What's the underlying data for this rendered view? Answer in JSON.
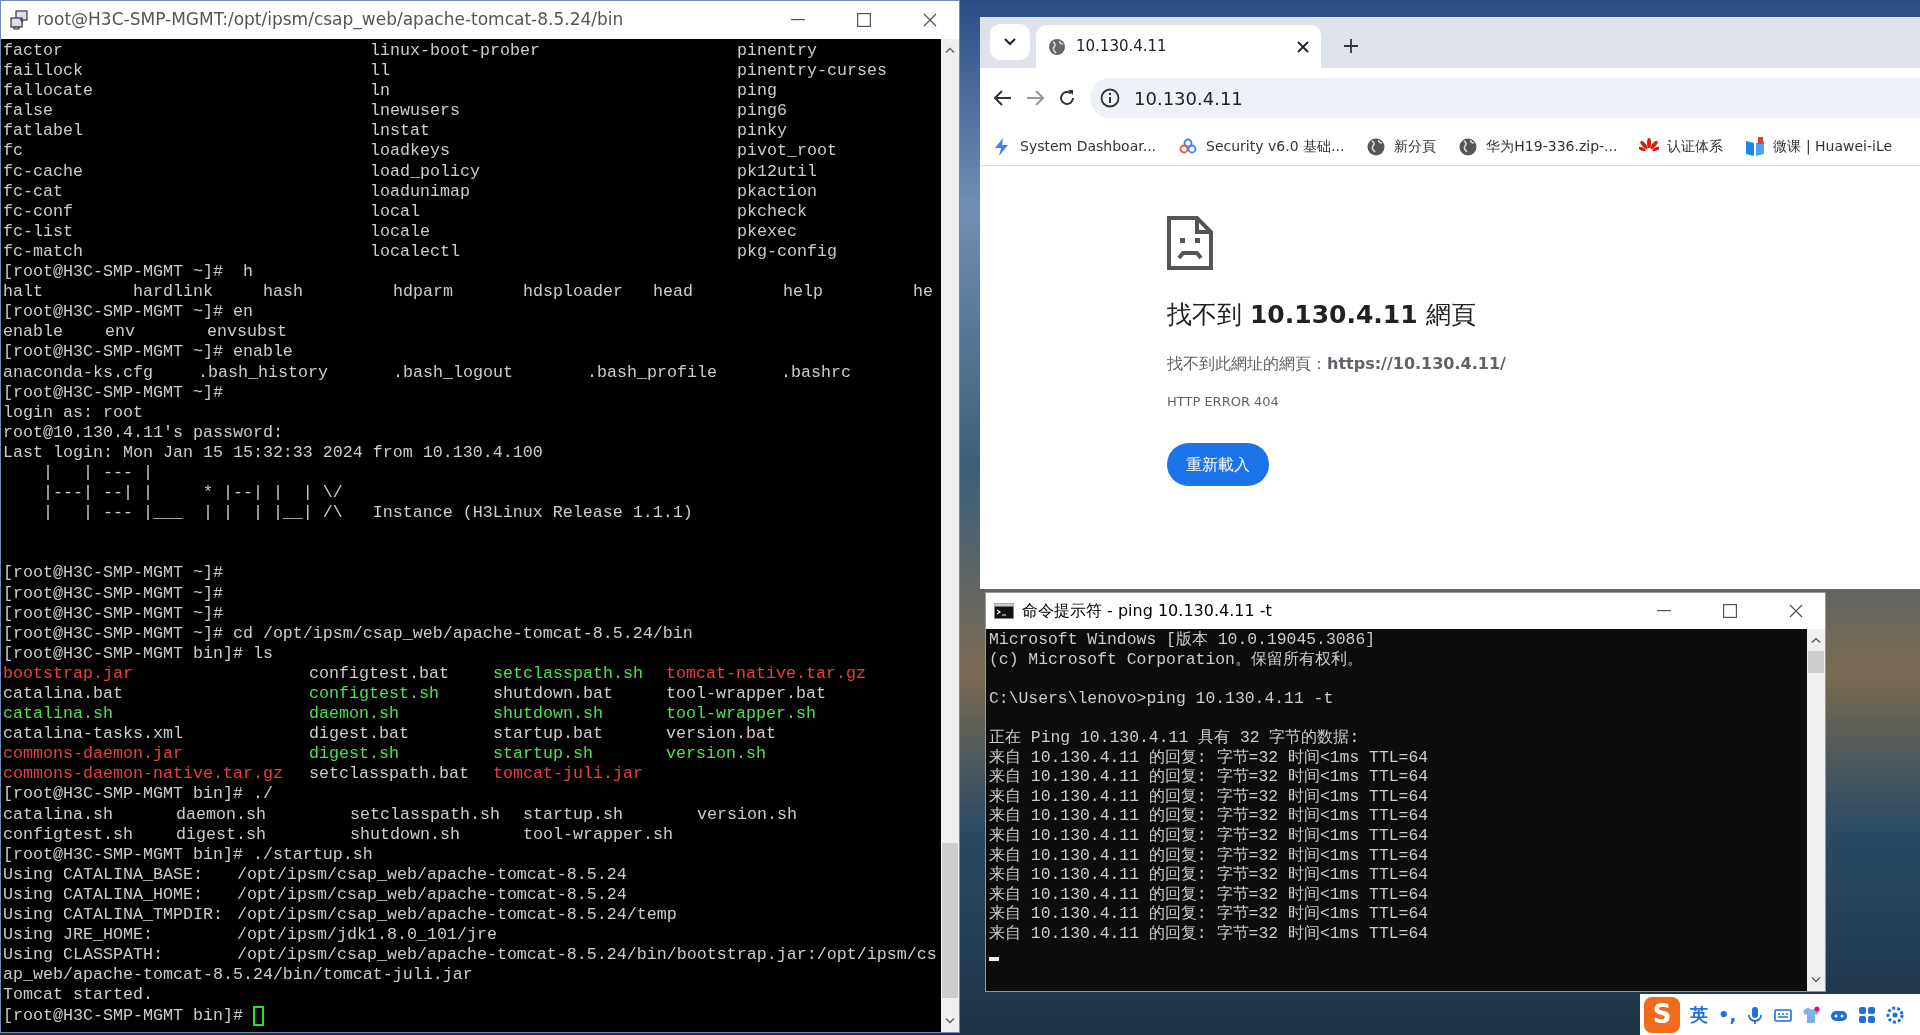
{
  "terminal_window": {
    "title": "root@H3C-SMP-MGMT:/opt/ipsm/csap_web/apache-tomcat-8.5.24/bin",
    "lines": [
      {
        "kind": "columns",
        "cells": [
          {
            "text": "factor"
          },
          {
            "text": "linux-boot-prober"
          },
          {
            "text": "pinentry"
          }
        ]
      },
      {
        "kind": "columns",
        "cells": [
          {
            "text": "faillock"
          },
          {
            "text": "ll"
          },
          {
            "text": "pinentry-curses"
          }
        ]
      },
      {
        "kind": "columns",
        "cells": [
          {
            "text": "fallocate"
          },
          {
            "text": "ln"
          },
          {
            "text": "ping"
          }
        ]
      },
      {
        "kind": "columns",
        "cells": [
          {
            "text": "false"
          },
          {
            "text": "lnewusers"
          },
          {
            "text": "ping6"
          }
        ]
      },
      {
        "kind": "columns",
        "cells": [
          {
            "text": "fatlabel"
          },
          {
            "text": "lnstat"
          },
          {
            "text": "pinky"
          }
        ]
      },
      {
        "kind": "columns",
        "cells": [
          {
            "text": "fc"
          },
          {
            "text": "loadkeys"
          },
          {
            "text": "pivot_root"
          }
        ]
      },
      {
        "kind": "columns",
        "cells": [
          {
            "text": "fc-cache"
          },
          {
            "text": "load_policy"
          },
          {
            "text": "pk12util"
          }
        ]
      },
      {
        "kind": "columns",
        "cells": [
          {
            "text": "fc-cat"
          },
          {
            "text": "loadunimap"
          },
          {
            "text": "pkaction"
          }
        ]
      },
      {
        "kind": "columns",
        "cells": [
          {
            "text": "fc-conf"
          },
          {
            "text": "local"
          },
          {
            "text": "pkcheck"
          }
        ]
      },
      {
        "kind": "columns",
        "cells": [
          {
            "text": "fc-list"
          },
          {
            "text": "locale"
          },
          {
            "text": "pkexec"
          }
        ]
      },
      {
        "kind": "columns",
        "cells": [
          {
            "text": "fc-match"
          },
          {
            "text": "localectl"
          },
          {
            "text": "pkg-config"
          }
        ]
      },
      {
        "kind": "text",
        "text": "[root@H3C-SMP-MGMT ~]#  h"
      },
      {
        "kind": "columns",
        "cells": [
          {
            "text": "halt"
          },
          {
            "text": "hardlink"
          },
          {
            "text": "hash"
          },
          {
            "text": "hdparm"
          },
          {
            "text": "hdsploader"
          },
          {
            "text": "head"
          },
          {
            "text": "help"
          },
          {
            "text": "he"
          }
        ]
      },
      {
        "kind": "text",
        "text": "[root@H3C-SMP-MGMT ~]# en"
      },
      {
        "kind": "columns",
        "cells": [
          {
            "text": "enable"
          },
          {
            "text": "env"
          },
          {
            "text": "envsubst"
          }
        ]
      },
      {
        "kind": "text",
        "text": "[root@H3C-SMP-MGMT ~]# enable"
      },
      {
        "kind": "columns",
        "cells": [
          {
            "text": "anaconda-ks.cfg"
          },
          {
            "text": ".bash_history"
          },
          {
            "text": ".bash_logout"
          },
          {
            "text": ".bash_profile"
          },
          {
            "text": ".bashrc"
          }
        ]
      },
      {
        "kind": "text",
        "text": "[root@H3C-SMP-MGMT ~]#"
      },
      {
        "kind": "text",
        "text": "login as: root"
      },
      {
        "kind": "text",
        "text": "root@10.130.4.11's password:"
      },
      {
        "kind": "text",
        "text": "Last login: Mon Jan 15 15:32:33 2024 from 10.130.4.100"
      },
      {
        "kind": "art",
        "text": "    |   | --- |"
      },
      {
        "kind": "art",
        "text": "    |---| --| |     * |--| |  | \\/"
      },
      {
        "kind": "art",
        "text": "    |   | --- |___  | |  | |__| /\\   Instance (H3Linux Release 1.1.1)"
      },
      {
        "kind": "blank"
      },
      {
        "kind": "blank"
      },
      {
        "kind": "text",
        "text": "[root@H3C-SMP-MGMT ~]#"
      },
      {
        "kind": "text",
        "text": "[root@H3C-SMP-MGMT ~]#"
      },
      {
        "kind": "text",
        "text": "[root@H3C-SMP-MGMT ~]#"
      },
      {
        "kind": "text",
        "text": "[root@H3C-SMP-MGMT ~]# cd /opt/ipsm/csap_web/apache-tomcat-8.5.24/bin"
      },
      {
        "kind": "text",
        "text": "[root@H3C-SMP-MGMT bin]# ls"
      },
      {
        "kind": "columns",
        "cells": [
          {
            "text": "bootstrap.jar",
            "color": "#e8413b"
          },
          {
            "text": "configtest.bat",
            "color": "#cccccc"
          },
          {
            "text": "setclasspath.sh",
            "color": "#4ee14e"
          },
          {
            "text": "tomcat-native.tar.gz",
            "color": "#e8413b"
          }
        ]
      },
      {
        "kind": "columns",
        "cells": [
          {
            "text": "catalina.bat",
            "color": "#cccccc"
          },
          {
            "text": "configtest.sh",
            "color": "#4ee14e"
          },
          {
            "text": "shutdown.bat",
            "color": "#cccccc"
          },
          {
            "text": "tool-wrapper.bat",
            "color": "#cccccc"
          }
        ]
      },
      {
        "kind": "columns",
        "cells": [
          {
            "text": "catalina.sh",
            "color": "#4ee14e"
          },
          {
            "text": "daemon.sh",
            "color": "#4ee14e"
          },
          {
            "text": "shutdown.sh",
            "color": "#4ee14e"
          },
          {
            "text": "tool-wrapper.sh",
            "color": "#4ee14e"
          }
        ]
      },
      {
        "kind": "columns",
        "cells": [
          {
            "text": "catalina-tasks.xml",
            "color": "#cccccc"
          },
          {
            "text": "digest.bat",
            "color": "#cccccc"
          },
          {
            "text": "startup.bat",
            "color": "#cccccc"
          },
          {
            "text": "version.bat",
            "color": "#cccccc"
          }
        ]
      },
      {
        "kind": "columns",
        "cells": [
          {
            "text": "commons-daemon.jar",
            "color": "#e8413b"
          },
          {
            "text": "digest.sh",
            "color": "#4ee14e"
          },
          {
            "text": "startup.sh",
            "color": "#4ee14e"
          },
          {
            "text": "version.sh",
            "color": "#4ee14e"
          }
        ]
      },
      {
        "kind": "columns",
        "cells": [
          {
            "text": "commons-daemon-native.tar.gz",
            "color": "#e8413b"
          },
          {
            "text": "setclasspath.bat",
            "color": "#cccccc"
          },
          {
            "text": "tomcat-juli.jar",
            "color": "#e8413b"
          }
        ]
      },
      {
        "kind": "text",
        "text": "[root@H3C-SMP-MGMT bin]# ./"
      },
      {
        "kind": "columns",
        "cells": [
          {
            "text": "catalina.sh"
          },
          {
            "text": "daemon.sh"
          },
          {
            "text": "setclasspath.sh"
          },
          {
            "text": "startup.sh"
          },
          {
            "text": "version.sh"
          }
        ]
      },
      {
        "kind": "columns",
        "cells": [
          {
            "text": "configtest.sh"
          },
          {
            "text": "digest.sh"
          },
          {
            "text": "shutdown.sh"
          },
          {
            "text": "tool-wrapper.sh"
          }
        ]
      },
      {
        "kind": "text",
        "text": "[root@H3C-SMP-MGMT bin]# ./startup.sh"
      },
      {
        "kind": "columns",
        "cells": [
          {
            "text": "Using CATALINA_BASE:"
          },
          {
            "text": "/opt/ipsm/csap_web/apache-tomcat-8.5.24"
          }
        ]
      },
      {
        "kind": "columns",
        "cells": [
          {
            "text": "Using CATALINA_HOME:"
          },
          {
            "text": "/opt/ipsm/csap_web/apache-tomcat-8.5.24"
          }
        ]
      },
      {
        "kind": "columns",
        "cells": [
          {
            "text": "Using CATALINA_TMPDIR:"
          },
          {
            "text": "/opt/ipsm/csap_web/apache-tomcat-8.5.24/temp"
          }
        ]
      },
      {
        "kind": "columns",
        "cells": [
          {
            "text": "Using JRE_HOME:"
          },
          {
            "text": "/opt/ipsm/jdk1.8.0_101/jre"
          }
        ]
      },
      {
        "kind": "columns",
        "cells": [
          {
            "text": "Using CLASSPATH:"
          },
          {
            "text": "/opt/ipsm/csap_web/apache-tomcat-8.5.24/bin/bootstrap.jar:/opt/ipsm/cs"
          }
        ]
      },
      {
        "kind": "text",
        "text": "ap_web/apache-tomcat-8.5.24/bin/tomcat-juli.jar"
      },
      {
        "kind": "text",
        "text": "Tomcat started."
      },
      {
        "kind": "text",
        "text": "[root@H3C-SMP-MGMT bin]#",
        "cursor": true
      }
    ]
  },
  "browser": {
    "tabs": [
      {
        "title": "10.130.4.11",
        "selected": true
      }
    ],
    "address": "10.130.4.11",
    "bookmarks": [
      {
        "kind": "bolt",
        "label": "System Dashboar..."
      },
      {
        "kind": "cluster",
        "label": "Security v6.0 基础..."
      },
      {
        "kind": "globe",
        "label": "新分頁"
      },
      {
        "kind": "globe",
        "label": "华为H19-336.zip-..."
      },
      {
        "kind": "flower",
        "label": "认证体系"
      },
      {
        "kind": "book",
        "label": "微课 | Huawei-iLe"
      }
    ],
    "error_page": {
      "heading": "找不到 **10.130.4.11** 網頁",
      "detail": "找不到此網址的網頁：**https://10.130.4.11/**",
      "code": "HTTP ERROR 404",
      "button": "重新載入"
    }
  },
  "console_window": {
    "title": "命令提示符 - ping  10.130.4.11 -t",
    "lines": [
      {
        "kind": "text",
        "text": "Microsoft Windows [版本 10.0.19045.3086]"
      },
      {
        "kind": "text",
        "text": "(c) Microsoft Corporation。保留所有权利。"
      },
      {
        "kind": "blank"
      },
      {
        "kind": "text",
        "text": "C:\\Users\\lenovo>ping 10.130.4.11 -t"
      },
      {
        "kind": "blank"
      },
      {
        "kind": "text",
        "text": "正在 Ping 10.130.4.11 具有 32 字节的数据:"
      },
      {
        "kind": "text",
        "text": "来自 10.130.4.11 的回复: 字节=32 时间<1ms TTL=64"
      },
      {
        "kind": "text",
        "text": "来自 10.130.4.11 的回复: 字节=32 时间<1ms TTL=64"
      },
      {
        "kind": "text",
        "text": "来自 10.130.4.11 的回复: 字节=32 时间<1ms TTL=64"
      },
      {
        "kind": "text",
        "text": "来自 10.130.4.11 的回复: 字节=32 时间<1ms TTL=64"
      },
      {
        "kind": "text",
        "text": "来自 10.130.4.11 的回复: 字节=32 时间<1ms TTL=64"
      },
      {
        "kind": "text",
        "text": "来自 10.130.4.11 的回复: 字节=32 时间<1ms TTL=64"
      },
      {
        "kind": "text",
        "text": "来自 10.130.4.11 的回复: 字节=32 时间<1ms TTL=64"
      },
      {
        "kind": "text",
        "text": "来自 10.130.4.11 的回复: 字节=32 时间<1ms TTL=64"
      },
      {
        "kind": "text",
        "text": "来自 10.130.4.11 的回复: 字节=32 时间<1ms TTL=64"
      },
      {
        "kind": "text",
        "text": "来自 10.130.4.11 的回复: 字节=32 时间<1ms TTL=64"
      },
      {
        "kind": "cursor"
      }
    ]
  },
  "ime_bar": {
    "logo": "S",
    "mode": "英",
    "punctuation": "•,"
  }
}
